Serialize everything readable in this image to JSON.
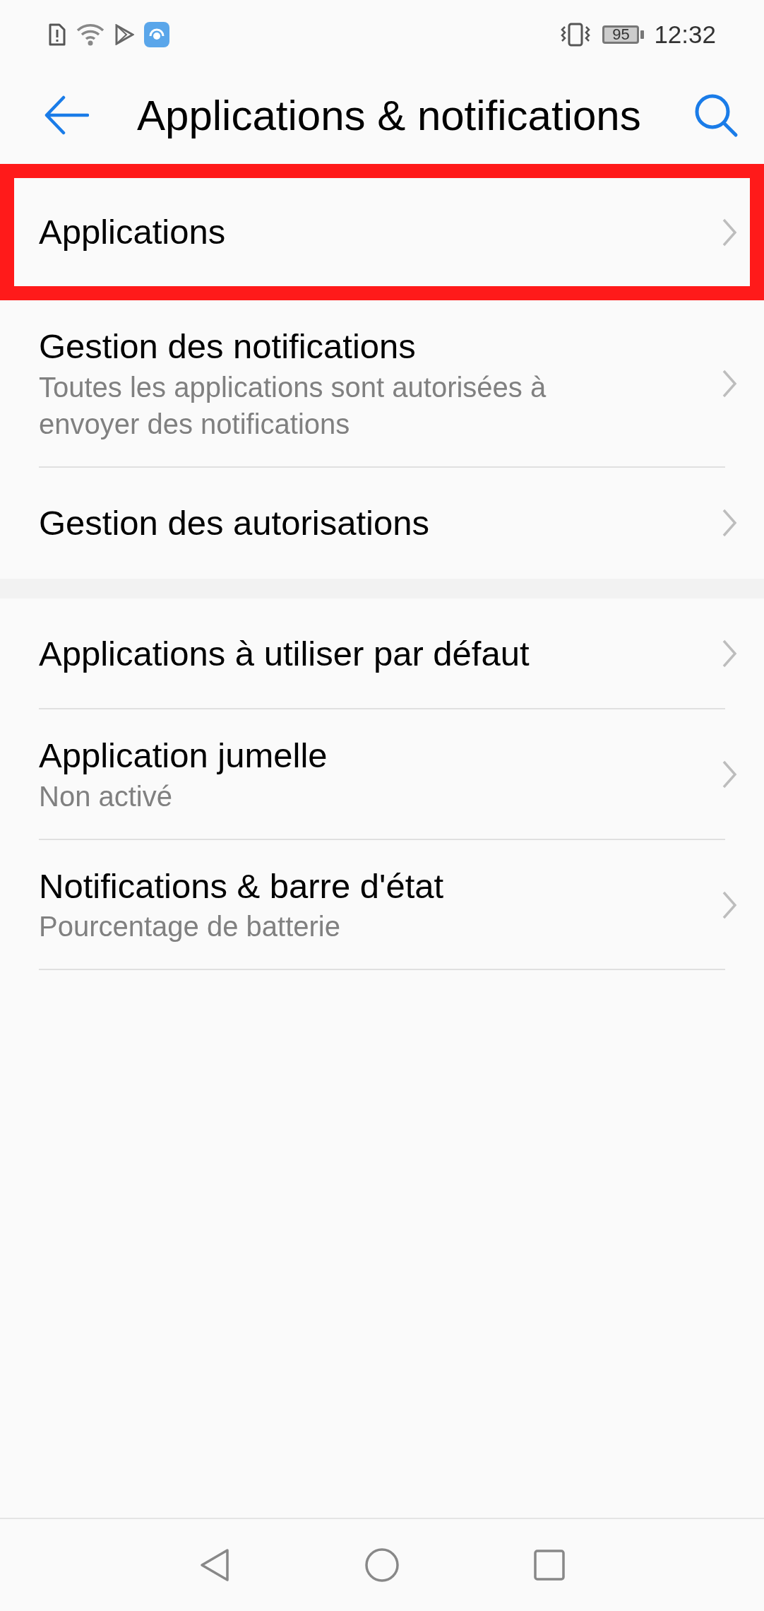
{
  "status_bar": {
    "battery": "95",
    "time": "12:32"
  },
  "header": {
    "title": "Applications & notifications"
  },
  "groups": [
    {
      "items": [
        {
          "title": "Applications",
          "highlighted": true
        },
        {
          "title": "Gestion des notifications",
          "subtitle": "Toutes les applications sont autorisées à envoyer des notifications",
          "highlighted": false
        },
        {
          "title": "Gestion des autorisations",
          "highlighted": false
        }
      ]
    },
    {
      "items": [
        {
          "title": "Applications à utiliser par défaut",
          "highlighted": false
        },
        {
          "title": "Application jumelle",
          "subtitle": "Non activé",
          "highlighted": false
        },
        {
          "title": "Notifications & barre d'état",
          "subtitle": "Pourcentage de batterie",
          "highlighted": false
        }
      ]
    }
  ]
}
